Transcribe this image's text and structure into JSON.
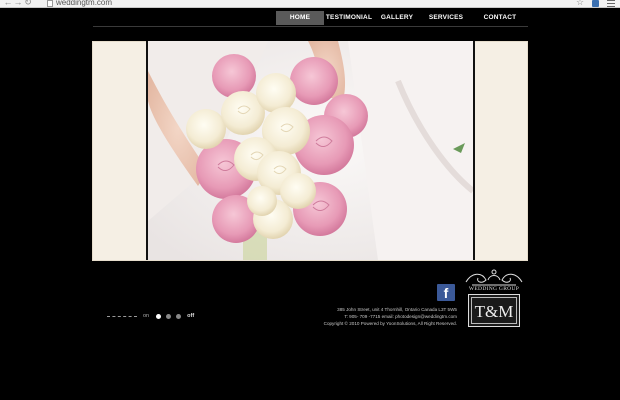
{
  "browser": {
    "back_icon": "back-arrow-icon",
    "forward_icon": "forward-arrow-icon",
    "reload_icon": "reload-icon",
    "url": "weddingtm.com"
  },
  "nav": {
    "items": [
      {
        "label": "HOME",
        "active": true
      },
      {
        "label": "TESTIMONIAL",
        "active": false
      },
      {
        "label": "GALLERY",
        "active": false
      },
      {
        "label": "SERVICES",
        "active": false
      },
      {
        "label": "CONTACT",
        "active": false
      }
    ]
  },
  "slideshow": {
    "on_label": "on",
    "off_label": "off",
    "dots": 3,
    "active_dot": 0
  },
  "footer": {
    "facebook_letter": "f",
    "address": "385 John Street, unit 4 Thornhill, Ontario Canada L3T 5W5",
    "contact": "T: 905- 709 -7715          email: photodesign@weddingtm.com",
    "copyright": "Copyright © 2010 Powered by YoonSolutions, All Right Reserved."
  },
  "logo": {
    "group_text": "WEDDING GROUP",
    "monogram": "T&M"
  },
  "colors": {
    "background": "#000000",
    "frame": "#f5efe4",
    "nav_active": "#5a5a5a",
    "facebook": "#3b5998"
  }
}
